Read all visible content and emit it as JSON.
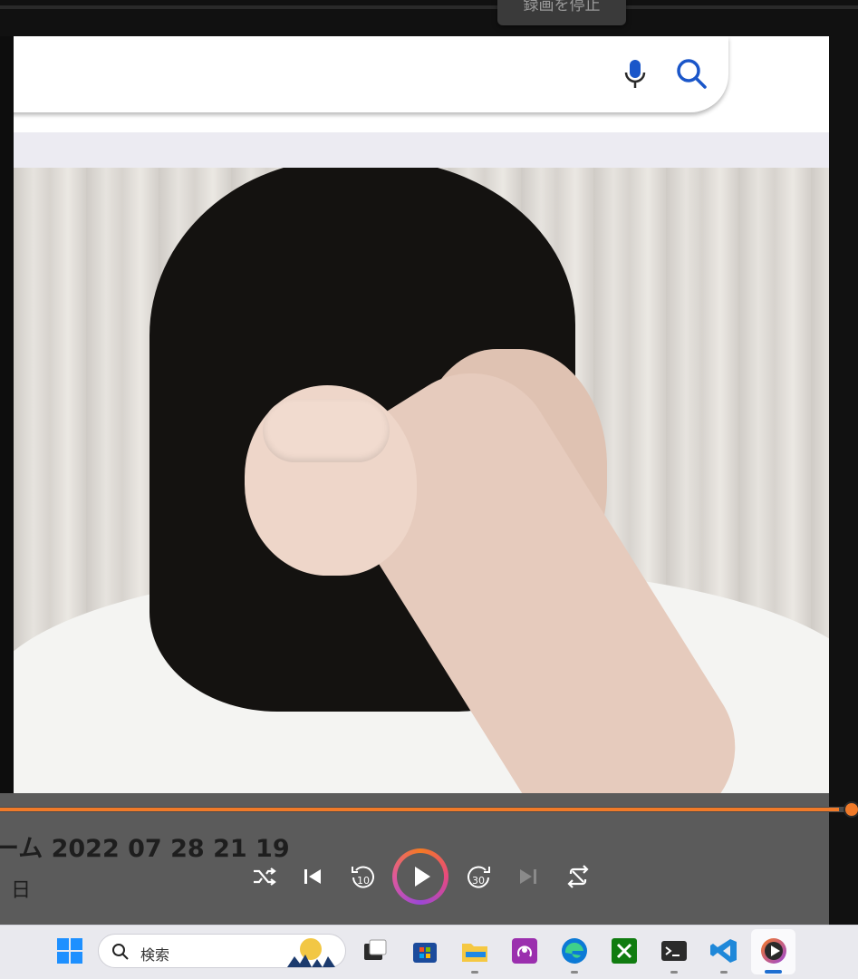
{
  "recording": {
    "stop_label": "録画を停止"
  },
  "player": {
    "track_title": "ーム 2022 07 28 21 19",
    "track_subtitle": "日",
    "progress": 0.985,
    "accent_color": "#f07a29",
    "controls": [
      "shuffle-icon",
      "previous-icon",
      "rewind-10-icon",
      "play-icon",
      "forward-30-icon",
      "next-icon",
      "repeat-icon"
    ],
    "rewind_label": "10",
    "forward_label": "30"
  },
  "search": {
    "icons": [
      "microphone-icon",
      "search-icon"
    ]
  },
  "taskbar": {
    "search_placeholder": "検索",
    "apps": [
      "start-icon",
      "search-icon",
      "task-view-icon",
      "store-icon",
      "file-explorer-icon",
      "app-icon",
      "edge-icon",
      "xbox-icon",
      "terminal-icon",
      "vscode-icon",
      "media-player-icon"
    ]
  }
}
